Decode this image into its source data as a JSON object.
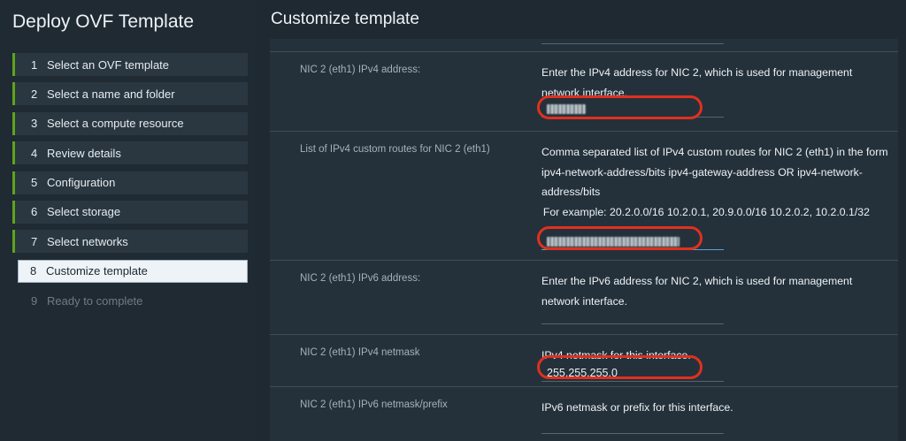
{
  "wizard": {
    "title": "Deploy OVF Template",
    "steps": [
      {
        "num": "1",
        "label": "Select an OVF template"
      },
      {
        "num": "2",
        "label": "Select a name and folder"
      },
      {
        "num": "3",
        "label": "Select a compute resource"
      },
      {
        "num": "4",
        "label": "Review details"
      },
      {
        "num": "5",
        "label": "Configuration"
      },
      {
        "num": "6",
        "label": "Select storage"
      },
      {
        "num": "7",
        "label": "Select networks"
      },
      {
        "num": "8",
        "label": "Customize template"
      },
      {
        "num": "9",
        "label": "Ready to complete"
      }
    ]
  },
  "main": {
    "title": "Customize template",
    "properties": [
      {
        "label": "NIC 2 (eth1) IPv4 address:",
        "description": "Enter the IPv4 address for NIC 2, which is used for management network interface.",
        "value": "",
        "value_redacted": true
      },
      {
        "label": "List of IPv4 custom routes for NIC 2 (eth1)",
        "description": "Comma separated list of IPv4 custom routes for NIC 2 (eth1) in the form ipv4-network-address/bits ipv4-gateway-address OR ipv4-network-address/bits",
        "example": "For example: 20.2.0.0/16 10.2.0.1, 20.9.0.0/16 10.2.0.2, 10.2.0.1/32",
        "value": "",
        "value_redacted": true
      },
      {
        "label": "NIC 2 (eth1) IPv6 address:",
        "description": "Enter the IPv6 address for NIC 2, which is used for management network interface.",
        "value": ""
      },
      {
        "label": "NIC 2 (eth1) IPv4 netmask",
        "description": "IPv4 netmask for this interface.",
        "value": "255.255.255.0"
      },
      {
        "label": "NIC 2 (eth1) IPv6 netmask/prefix",
        "description": "IPv6 netmask or prefix for this interface.",
        "value": ""
      }
    ]
  },
  "colors": {
    "step_accent": "#5ea41a",
    "annotation": "#e0301e",
    "focus": "#5a9fd4"
  }
}
